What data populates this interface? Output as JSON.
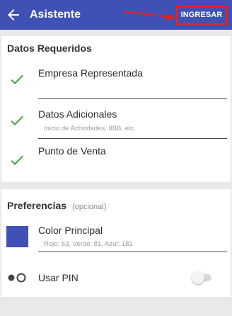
{
  "header": {
    "title": "Asistente",
    "action_label": "INGRESAR",
    "bar_color": "#3f51b5",
    "highlight_color": "#e8221e"
  },
  "required": {
    "title": "Datos Requeridos",
    "items": [
      {
        "label": "Empresa Representada",
        "subtitle": "",
        "checked": true,
        "icon": "check-icon"
      },
      {
        "label": "Datos Adicionales",
        "subtitle": "Inicio de Actividades, IIBB, etc.",
        "checked": true,
        "icon": "check-icon"
      },
      {
        "label": "Punto de Venta",
        "subtitle": "",
        "checked": true,
        "icon": "check-icon"
      }
    ],
    "check_color": "#43a047"
  },
  "preferences": {
    "title": "Preferencias",
    "optional_label": "(opcional)",
    "color": {
      "label": "Color Principal",
      "detail": "Rojo: 63, Verde: 81, Azul: 181",
      "swatch": "#3f51b5"
    },
    "pin": {
      "label": "Usar PIN",
      "enabled": false,
      "icon": "pin-dots-icon"
    }
  }
}
